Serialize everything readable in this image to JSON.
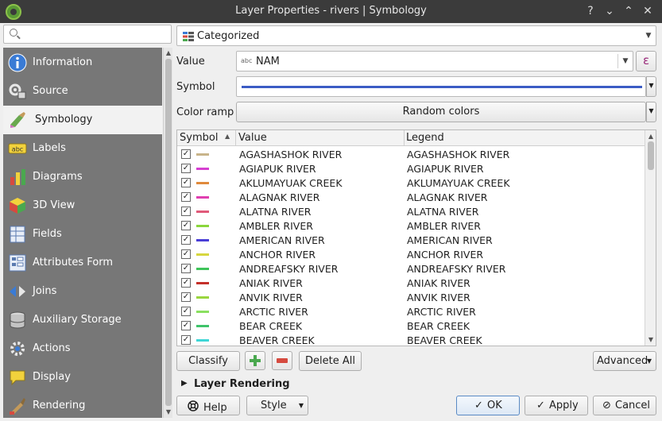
{
  "window": {
    "title": "Layer Properties - rivers | Symbology",
    "controls": [
      "?",
      "⌄",
      "⌃",
      "✕"
    ]
  },
  "sidebar": {
    "search_placeholder": "",
    "items": [
      {
        "label": "Information",
        "icon": "information-icon"
      },
      {
        "label": "Source",
        "icon": "source-icon"
      },
      {
        "label": "Symbology",
        "icon": "symbology-icon"
      },
      {
        "label": "Labels",
        "icon": "labels-icon"
      },
      {
        "label": "Diagrams",
        "icon": "diagrams-icon"
      },
      {
        "label": "3D View",
        "icon": "3d-view-icon"
      },
      {
        "label": "Fields",
        "icon": "fields-icon"
      },
      {
        "label": "Attributes Form",
        "icon": "attributes-form-icon"
      },
      {
        "label": "Joins",
        "icon": "joins-icon"
      },
      {
        "label": "Auxiliary Storage",
        "icon": "auxiliary-storage-icon"
      },
      {
        "label": "Actions",
        "icon": "actions-icon"
      },
      {
        "label": "Display",
        "icon": "display-icon"
      },
      {
        "label": "Rendering",
        "icon": "rendering-icon"
      }
    ],
    "active_index": 2
  },
  "renderer": {
    "type_label": "Categorized"
  },
  "value_row": {
    "label": "Value",
    "field_tag": "abc",
    "field": "NAM",
    "expression_button": "ε"
  },
  "symbol_row": {
    "label": "Symbol",
    "line_color": "#3b5cc4"
  },
  "color_ramp_row": {
    "label": "Color ramp",
    "value": "Random colors"
  },
  "table": {
    "headers": {
      "symbol": "Symbol",
      "value": "Value",
      "legend": "Legend"
    },
    "rows": [
      {
        "value": "AGASHASHOK RIVER",
        "legend": "AGASHASHOK RIVER",
        "color": "#c8b48a",
        "checked": true
      },
      {
        "value": "AGIAPUK RIVER",
        "legend": "AGIAPUK RIVER",
        "color": "#d63fd0",
        "checked": true
      },
      {
        "value": "AKLUMAYUAK CREEK",
        "legend": "AKLUMAYUAK CREEK",
        "color": "#e08a3c",
        "checked": true
      },
      {
        "value": "ALAGNAK RIVER",
        "legend": "ALAGNAK RIVER",
        "color": "#e03fb0",
        "checked": true
      },
      {
        "value": "ALATNA RIVER",
        "legend": "ALATNA RIVER",
        "color": "#e05a7a",
        "checked": true
      },
      {
        "value": "AMBLER RIVER",
        "legend": "AMBLER RIVER",
        "color": "#8ad63c",
        "checked": true
      },
      {
        "value": "AMERICAN RIVER",
        "legend": "AMERICAN RIVER",
        "color": "#4a3fd6",
        "checked": true
      },
      {
        "value": "ANCHOR RIVER",
        "legend": "ANCHOR RIVER",
        "color": "#d6d63f",
        "checked": true
      },
      {
        "value": "ANDREAFSKY RIVER",
        "legend": "ANDREAFSKY RIVER",
        "color": "#3fc45a",
        "checked": true
      },
      {
        "value": "ANIAK RIVER",
        "legend": "ANIAK RIVER",
        "color": "#c4302a",
        "checked": true
      },
      {
        "value": "ANVIK RIVER",
        "legend": "ANVIK RIVER",
        "color": "#9ad63f",
        "checked": true
      },
      {
        "value": "ARCTIC RIVER",
        "legend": "ARCTIC RIVER",
        "color": "#8ae060",
        "checked": true
      },
      {
        "value": "BEAR CREEK",
        "legend": "BEAR CREEK",
        "color": "#3fc46a",
        "checked": true
      },
      {
        "value": "BEAVER CREEK",
        "legend": "BEAVER CREEK",
        "color": "#3fd6d6",
        "checked": true
      }
    ]
  },
  "actions": {
    "classify": "Classify",
    "delete_all": "Delete All",
    "advanced": "Advanced"
  },
  "layer_rendering": {
    "label": "Layer Rendering"
  },
  "footer": {
    "help": "Help",
    "style": "Style",
    "ok": "OK",
    "apply": "Apply",
    "cancel": "Cancel"
  }
}
